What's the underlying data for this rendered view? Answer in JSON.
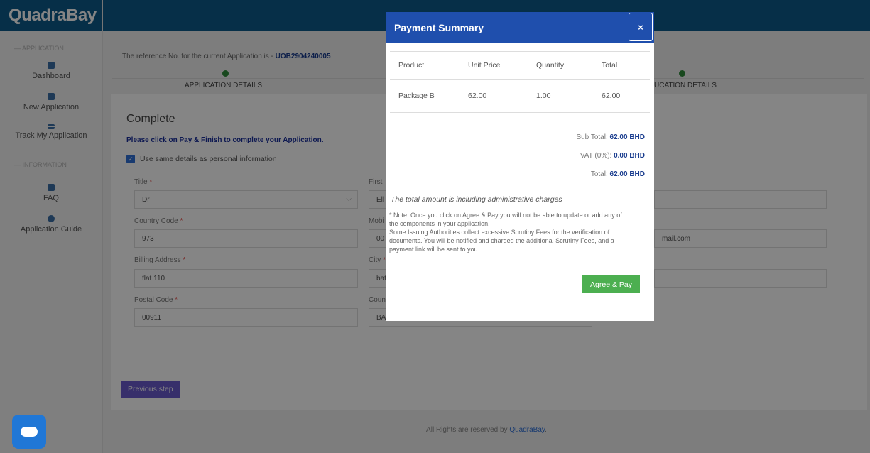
{
  "app": {
    "logo_text": "QuadraBay"
  },
  "sidebar": {
    "section_application": "— APPLICATION",
    "section_information": "— INFORMATION",
    "items": [
      {
        "label": "Dashboard",
        "icon": "dashboard-icon"
      },
      {
        "label": "New Application",
        "icon": "document-icon"
      },
      {
        "label": "Track My Application",
        "icon": "list-check-icon"
      },
      {
        "label": "FAQ",
        "icon": "faq-icon"
      },
      {
        "label": "Application Guide",
        "icon": "guide-icon"
      }
    ]
  },
  "main": {
    "ref_prefix": "The reference No. for the current Application is - ",
    "ref_no": "UOB2904240005",
    "steps": [
      {
        "label": "APPLICATION DETAILS"
      },
      {
        "label": "UCATION DETAILS"
      }
    ],
    "title": "Complete",
    "instruction": "Please click on Pay & Finish to complete your Application.",
    "same_details_label": "Use same details as personal information",
    "fields": {
      "title_label": "Title",
      "title_value": "Dr",
      "first_label": "First",
      "first_value": "Ell",
      "country_code_label": "Country Code",
      "country_code_value": "973",
      "mobile_label": "Mobi",
      "mobile_value": "00",
      "email_value": "mail.com",
      "billing_label": "Billing Address",
      "billing_value": "flat 110",
      "city_label": "City",
      "city_value": "bat",
      "postal_label": "Postal Code",
      "postal_value": "00911",
      "country_label": "Coun",
      "country_value": "BA"
    },
    "prev_button": "Previous step",
    "footer_prefix": "All Rights are reserved by ",
    "footer_brand": "QuadraBay",
    "footer_suffix": "."
  },
  "modal": {
    "title": "Payment Summary",
    "close_label": "×",
    "columns": [
      "Product",
      "Unit Price",
      "Quantity",
      "Total"
    ],
    "rows": [
      {
        "product": "Package B",
        "unit_price": "62.00",
        "quantity": "1.00",
        "total": "62.00"
      }
    ],
    "sub_total_label": "Sub Total:",
    "sub_total_value": "62.00 BHD",
    "vat_label": "VAT (0%):",
    "vat_value": "0.00 BHD",
    "total_label": "Total:",
    "total_value": "62.00 BHD",
    "admin_note": "The total amount is including administrative charges",
    "note_lines": [
      "* Note: Once you click on Agree & Pay you will not be able to update or add any of",
      "the components in your application.",
      "Some Issuing Authorities collect excessive Scrutiny Fees for the verification of",
      "documents. You will be notified and charged the additional Scrutiny Fees, and a",
      "payment link will be sent to you."
    ],
    "agree_button": "Agree & Pay"
  },
  "colors": {
    "header_blue": "#0c5b8a",
    "modal_blue": "#1f4fad",
    "agree_green": "#4caf50",
    "prev_purple": "#6a5acd",
    "step_green": "#2e8b3a"
  }
}
